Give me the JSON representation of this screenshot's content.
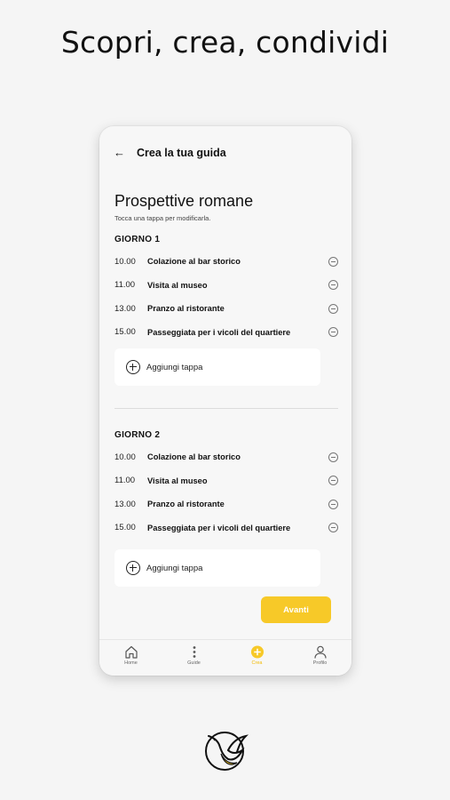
{
  "headline": "Scopri, crea, condividi",
  "header": {
    "title": "Crea la tua guida"
  },
  "guide": {
    "title": "Prospettive romane",
    "subtitle": "Tocca una tappa per modificarla."
  },
  "days": [
    {
      "title": "GIORNO 1",
      "stops": [
        {
          "time": "10.00",
          "name": "Colazione al bar storico"
        },
        {
          "time": "11.00",
          "name": "Visita al museo"
        },
        {
          "time": "13.00",
          "name": "Pranzo al ristorante"
        },
        {
          "time": "15.00",
          "name": "Passeggiata per i vicoli del quartiere"
        }
      ],
      "add_label": "Aggiungi tappa"
    },
    {
      "title": "GIORNO 2",
      "stops": [
        {
          "time": "10.00",
          "name": "Colazione al bar storico"
        },
        {
          "time": "11.00",
          "name": "Visita al museo"
        },
        {
          "time": "13.00",
          "name": "Pranzo al ristorante"
        },
        {
          "time": "15.00",
          "name": "Passeggiata per i vicoli del quartiere"
        }
      ],
      "add_label": "Aggiungi tappa"
    }
  ],
  "next_button": "Avanti",
  "tabs": [
    {
      "label": "Home",
      "icon": "home-icon"
    },
    {
      "label": "Guide",
      "icon": "more-vertical-icon"
    },
    {
      "label": "Crea",
      "icon": "plus-circle-icon",
      "active": true
    },
    {
      "label": "Profilo",
      "icon": "user-icon"
    }
  ],
  "colors": {
    "accent": "#f7c928",
    "active_tab": "#f2b900"
  }
}
